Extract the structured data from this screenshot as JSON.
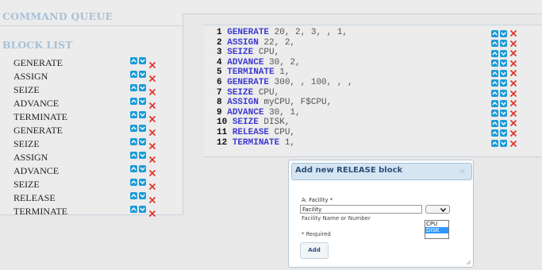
{
  "left_panel": {
    "command_queue_title": "COMMAND QUEUE",
    "block_list_title": "BLOCK LIST",
    "blocks": [
      {
        "name": "GENERATE"
      },
      {
        "name": "ASSIGN"
      },
      {
        "name": "SEIZE"
      },
      {
        "name": "ADVANCE"
      },
      {
        "name": "TERMINATE"
      },
      {
        "name": "GENERATE"
      },
      {
        "name": "SEIZE"
      },
      {
        "name": "ASSIGN"
      },
      {
        "name": "ADVANCE"
      },
      {
        "name": "SEIZE"
      },
      {
        "name": "RELEASE"
      },
      {
        "name": "TERMINATE"
      }
    ]
  },
  "code_lines": [
    {
      "num": "1",
      "kw": "GENERATE",
      "args": " 20, 2, 3, , 1,"
    },
    {
      "num": "2",
      "kw": "ASSIGN",
      "args": " 22, 2,"
    },
    {
      "num": "3",
      "kw": "SEIZE",
      "args": " CPU,"
    },
    {
      "num": "4",
      "kw": "ADVANCE",
      "args": " 30, 2,"
    },
    {
      "num": "5",
      "kw": "TERMINATE",
      "args": " 1,"
    },
    {
      "num": "6",
      "kw": "GENERATE",
      "args": " 300, , 100, , ,"
    },
    {
      "num": "7",
      "kw": "SEIZE",
      "args": " CPU,"
    },
    {
      "num": "8",
      "kw": "ASSIGN",
      "args": " myCPU, F$CPU,"
    },
    {
      "num": "9",
      "kw": "ADVANCE",
      "args": " 30, 1,"
    },
    {
      "num": "10",
      "kw": "SEIZE",
      "args": " DISK,"
    },
    {
      "num": "11",
      "kw": "RELEASE",
      "args": " CPU,"
    },
    {
      "num": "12",
      "kw": "TERMINATE",
      "args": " 1,"
    }
  ],
  "dialog": {
    "title": "Add new RELEASE block",
    "close_glyph": "×",
    "field_label": "A: Facility *",
    "field_value": "Facility",
    "field_hint": "Facility Name or Number",
    "required_note": "* Required",
    "add_label": "Add",
    "select_options": [
      "CPU",
      "DISK"
    ],
    "selected_option": "DISK"
  },
  "colors": {
    "accent_blue": "#1b9ad6",
    "delete_red": "#e0302a",
    "keyword": "#3d3ad0"
  },
  "icons": {
    "move_up": "chevron-up-icon",
    "move_down": "chevron-down-icon",
    "delete": "close-icon"
  }
}
